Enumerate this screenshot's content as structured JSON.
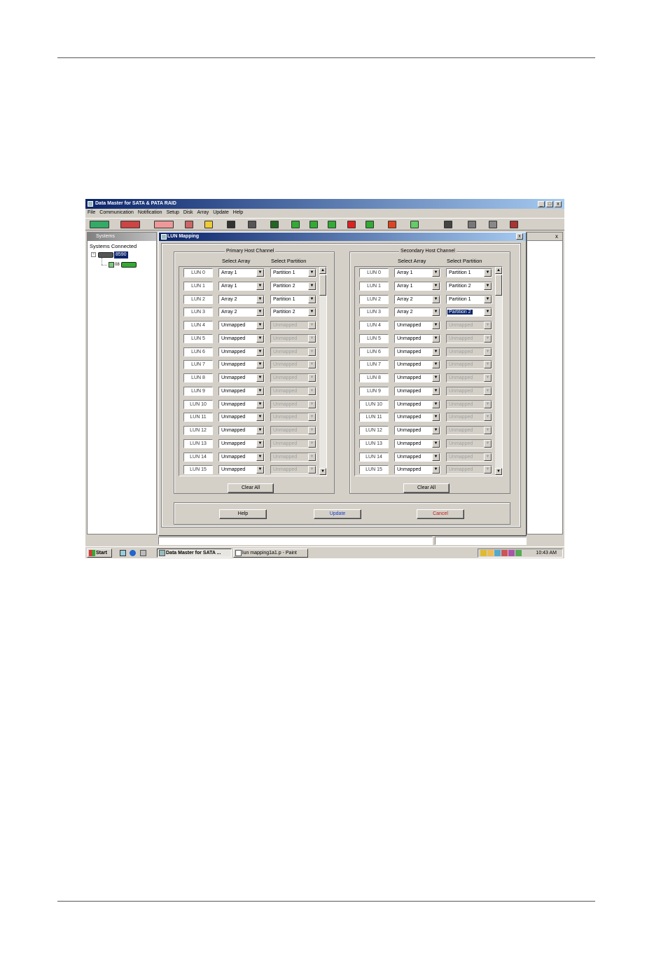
{
  "app": {
    "title": "Data Master for SATA & PATA RAID",
    "window_buttons": [
      "_",
      "□",
      "x"
    ]
  },
  "menu": [
    "File",
    "Communication",
    "Notification",
    "Setup",
    "Disk",
    "Array",
    "Update",
    "Help"
  ],
  "toolbar_icons": [
    "connect-icon",
    "disconnect-icon",
    "notify-off-icon",
    "stop-icon",
    "wizard-icon",
    "disk-icon",
    "disk2-icon",
    "disk3-icon",
    "array-icon",
    "array2-icon",
    "array3-icon",
    "array4-icon",
    "array5-icon",
    "lun-icon",
    "network-icon",
    "refresh-icon",
    "help-icon",
    "clock-icon",
    "power-icon"
  ],
  "systems": {
    "title": "Systems",
    "root_label": "Systems Connected",
    "node_label": "8590",
    "child_label": "08"
  },
  "dialog": {
    "title": "LUN Mapping",
    "close": "x",
    "primary": {
      "label": "Primary Host Channel",
      "col_array": "Select Array",
      "col_partition": "Select Partition",
      "rows": [
        {
          "lun": "LUN 0",
          "array": "Array 1",
          "partition": "Partition 1",
          "disabled": false
        },
        {
          "lun": "LUN 1",
          "array": "Array 1",
          "partition": "Partition 2",
          "disabled": false
        },
        {
          "lun": "LUN 2",
          "array": "Array 2",
          "partition": "Partition 1",
          "disabled": false
        },
        {
          "lun": "LUN 3",
          "array": "Array 2",
          "partition": "Partition 2",
          "disabled": false
        },
        {
          "lun": "LUN 4",
          "array": "Unmapped",
          "partition": "Unmapped",
          "disabled": true
        },
        {
          "lun": "LUN 5",
          "array": "Unmapped",
          "partition": "Unmapped",
          "disabled": true
        },
        {
          "lun": "LUN 6",
          "array": "Unmapped",
          "partition": "Unmapped",
          "disabled": true
        },
        {
          "lun": "LUN 7",
          "array": "Unmapped",
          "partition": "Unmapped",
          "disabled": true
        },
        {
          "lun": "LUN 8",
          "array": "Unmapped",
          "partition": "Unmapped",
          "disabled": true
        },
        {
          "lun": "LUN 9",
          "array": "Unmapped",
          "partition": "Unmapped",
          "disabled": true
        },
        {
          "lun": "LUN 10",
          "array": "Unmapped",
          "partition": "Unmapped",
          "disabled": true
        },
        {
          "lun": "LUN 11",
          "array": "Unmapped",
          "partition": "Unmapped",
          "disabled": true
        },
        {
          "lun": "LUN 12",
          "array": "Unmapped",
          "partition": "Unmapped",
          "disabled": true
        },
        {
          "lun": "LUN 13",
          "array": "Unmapped",
          "partition": "Unmapped",
          "disabled": true
        },
        {
          "lun": "LUN 14",
          "array": "Unmapped",
          "partition": "Unmapped",
          "disabled": true
        },
        {
          "lun": "LUN 15",
          "array": "Unmapped",
          "partition": "Unmapped",
          "disabled": true
        }
      ],
      "clear_all": "Clear All"
    },
    "secondary": {
      "label": "Secondary Host Channel",
      "col_array": "Select Array",
      "col_partition": "Select Partition",
      "rows": [
        {
          "lun": "LUN 0",
          "array": "Array 1",
          "partition": "Partition 1",
          "disabled": false
        },
        {
          "lun": "LUN 1",
          "array": "Array 1",
          "partition": "Partition 2",
          "disabled": false
        },
        {
          "lun": "LUN 2",
          "array": "Array 2",
          "partition": "Partition 1",
          "disabled": false
        },
        {
          "lun": "LUN 3",
          "array": "Array 2",
          "partition": "Partition 2",
          "disabled": false,
          "selected": true
        },
        {
          "lun": "LUN 4",
          "array": "Unmapped",
          "partition": "Unmapped",
          "disabled": true
        },
        {
          "lun": "LUN 5",
          "array": "Unmapped",
          "partition": "Unmapped",
          "disabled": true
        },
        {
          "lun": "LUN 6",
          "array": "Unmapped",
          "partition": "Unmapped",
          "disabled": true
        },
        {
          "lun": "LUN 7",
          "array": "Unmapped",
          "partition": "Unmapped",
          "disabled": true
        },
        {
          "lun": "LUN 8",
          "array": "Unmapped",
          "partition": "Unmapped",
          "disabled": true
        },
        {
          "lun": "LUN 9",
          "array": "Unmapped",
          "partition": "Unmapped",
          "disabled": true
        },
        {
          "lun": "LUN 10",
          "array": "Unmapped",
          "partition": "Unmapped",
          "disabled": true
        },
        {
          "lun": "LUN 11",
          "array": "Unmapped",
          "partition": "Unmapped",
          "disabled": true
        },
        {
          "lun": "LUN 12",
          "array": "Unmapped",
          "partition": "Unmapped",
          "disabled": true
        },
        {
          "lun": "LUN 13",
          "array": "Unmapped",
          "partition": "Unmapped",
          "disabled": true
        },
        {
          "lun": "LUN 14",
          "array": "Unmapped",
          "partition": "Unmapped",
          "disabled": true
        },
        {
          "lun": "LUN 15",
          "array": "Unmapped",
          "partition": "Unmapped",
          "disabled": true
        }
      ],
      "clear_all": "Clear All"
    },
    "buttons": {
      "help": "Help",
      "update": "Update",
      "cancel": "Cancel"
    }
  },
  "taskbar": {
    "start": "Start",
    "tasks": [
      "Data Master for SATA ...",
      "lun mapping1a1.p - Paint"
    ],
    "clock": "10:43 AM"
  },
  "colors": {
    "title_active": "#0a246a",
    "update_text": "#1a3fbf",
    "cancel_text": "#c02020",
    "face": "#d4d0c8"
  }
}
